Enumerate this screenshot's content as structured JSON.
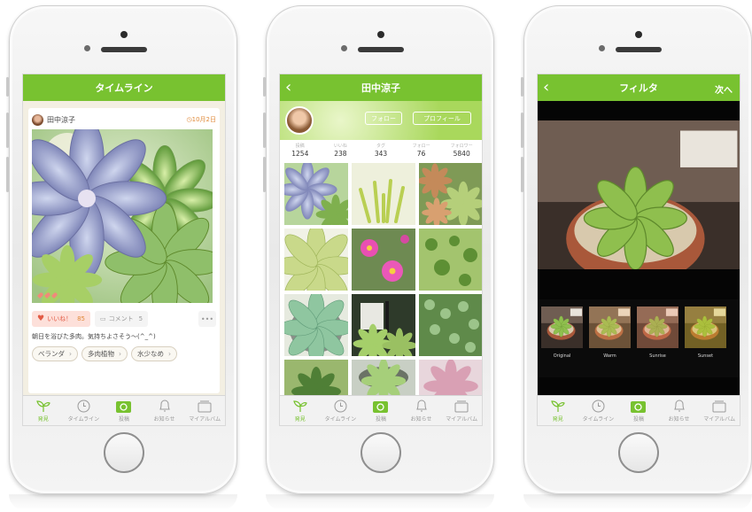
{
  "tabs": [
    {
      "label": "発見",
      "icon": "sprout-icon"
    },
    {
      "label": "タイムライン",
      "icon": "clock-icon"
    },
    {
      "label": "投稿",
      "icon": "camera-icon"
    },
    {
      "label": "お知らせ",
      "icon": "bell-icon"
    },
    {
      "label": "マイアルバム",
      "icon": "album-icon"
    }
  ],
  "timeline": {
    "title": "タイムライン",
    "post": {
      "user": "田中涼子",
      "date": "10月2日",
      "like_label": "いいね！",
      "like_count": "85",
      "comment_label": "コメント",
      "comment_count": "5",
      "more": "•••",
      "caption": "朝日を浴びた多肉。気持ちよさそう〜(^_^)",
      "tags": [
        "ベランダ",
        "多肉植物",
        "水少なめ"
      ]
    }
  },
  "profile": {
    "title": "田中涼子",
    "follow_button": "フォロー",
    "profile_button": "プロフィール",
    "stats": [
      {
        "label": "投稿",
        "value": "1254"
      },
      {
        "label": "いいね",
        "value": "238"
      },
      {
        "label": "タグ",
        "value": "343"
      },
      {
        "label": "フォロー",
        "value": "76"
      },
      {
        "label": "フォロワー",
        "value": "5840"
      }
    ]
  },
  "filter_screen": {
    "title": "フィルタ",
    "next": "次へ",
    "filters": [
      "Original",
      "Warm",
      "Sunrise",
      "Sunset"
    ]
  },
  "colors": {
    "accent": "#78c230",
    "like": "#e25b45",
    "date": "#e08a3a"
  }
}
